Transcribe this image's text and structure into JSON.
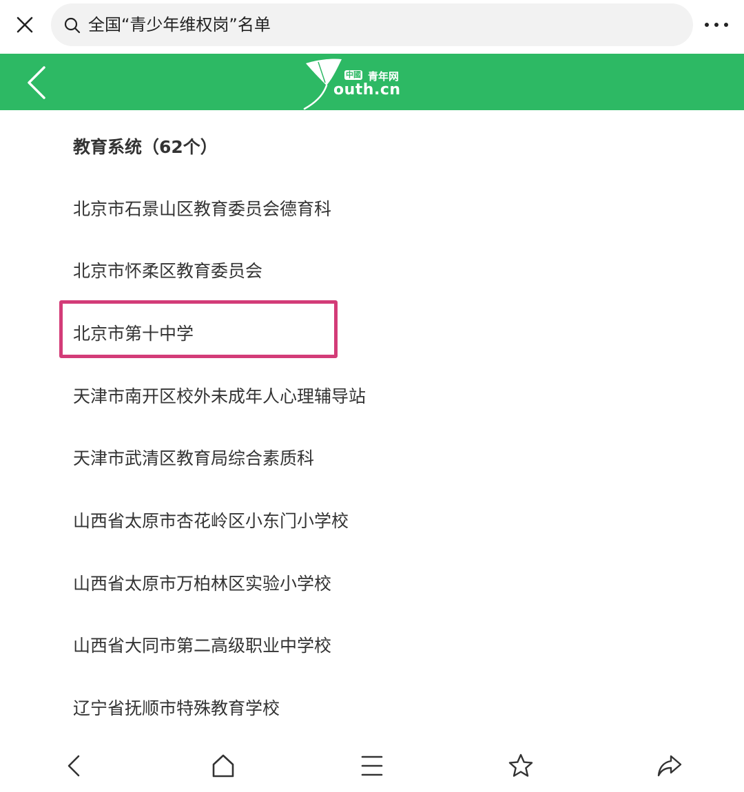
{
  "browser": {
    "search_query": "全国“青少年维权岗”名单",
    "icons": {
      "close": "close-icon",
      "search": "search-icon",
      "more": "more-dots-icon"
    }
  },
  "site_header": {
    "background_color": "#2db964",
    "logo": {
      "badge_text": "中國",
      "chinese_name": "青年网",
      "domain": "outh.cn"
    },
    "back_icon": "chevron-left-icon"
  },
  "content": {
    "heading": "教育系统（62个）",
    "items": [
      "北京市石景山区教育委员会德育科",
      "北京市怀柔区教育委员会",
      "北京市第十中学",
      "天津市南开区校外未成年人心理辅导站",
      "天津市武清区教育局综合素质科",
      "山西省太原市杏花岭区小东门小学校",
      "山西省太原市万柏林区实验小学校",
      "山西省大同市第二高级职业中学校",
      "辽宁省抚顺市特殊教育学校"
    ],
    "highlighted_item": "北京市第十中学",
    "highlight_color": "#d33c78"
  },
  "bottom_nav": {
    "items": [
      "back-icon",
      "home-icon",
      "menu-icon",
      "star-icon",
      "share-icon"
    ]
  }
}
